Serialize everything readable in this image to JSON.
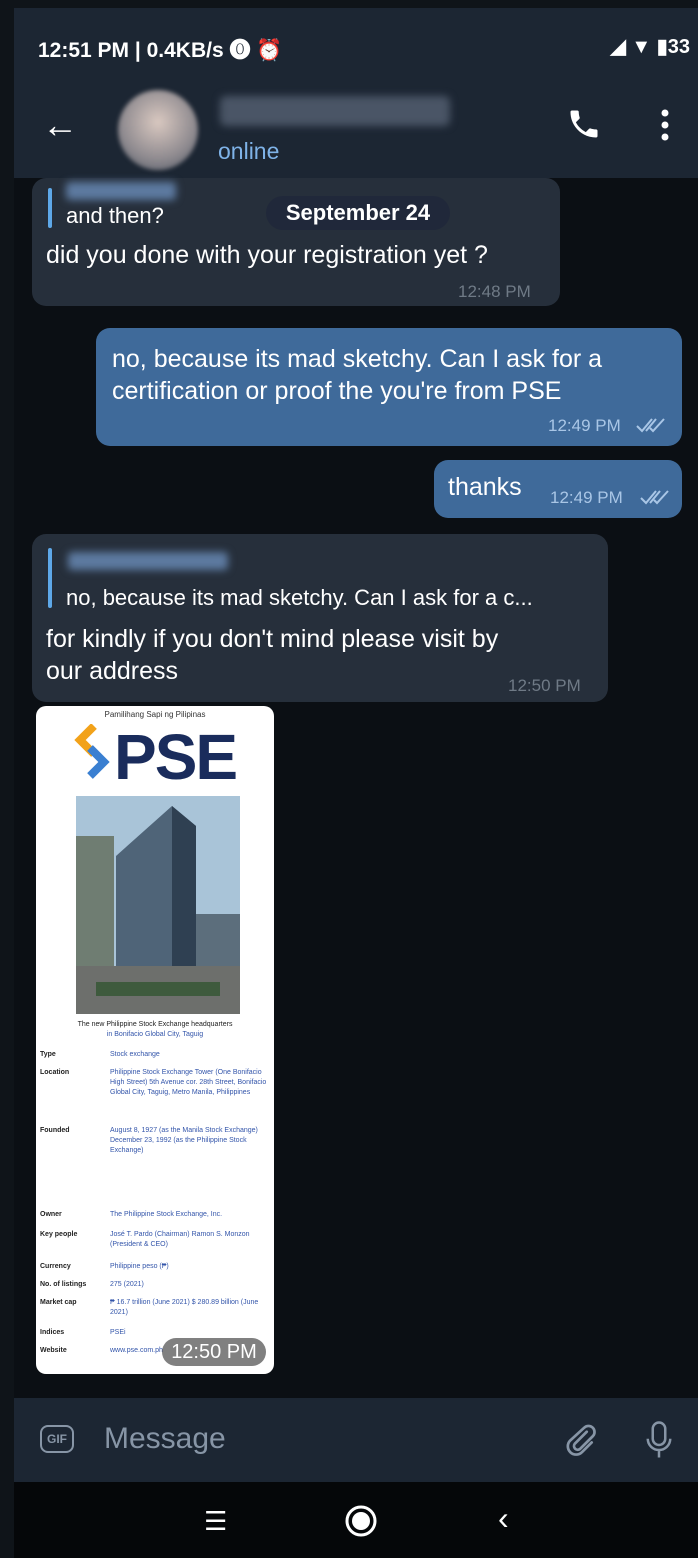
{
  "status_bar": {
    "time": "12:51 PM | 0.4KB/s ⓿ ⏰",
    "right": "◢ ▼ ▮33"
  },
  "header": {
    "back_icon": "arrow-left-icon",
    "presence": "online",
    "call_icon": "phone-icon",
    "menu_icon": "more-vert-icon"
  },
  "chat": {
    "date_separator": "September 24",
    "messages": [
      {
        "direction": "in",
        "reply_text": "and then?",
        "text": "did you done with your registration yet ?",
        "time": "12:48 PM"
      },
      {
        "direction": "out",
        "text_line1": "no, because its mad sketchy. Can I ask for a",
        "text_line2": "certification or proof the you're from PSE",
        "time": "12:49 PM",
        "status_icon": "double-check-icon"
      },
      {
        "direction": "out",
        "text": "thanks",
        "time": "12:49 PM",
        "status_icon": "double-check-icon"
      },
      {
        "direction": "in",
        "reply_text": "no, because its mad sketchy. Can I ask for a c...",
        "text_line1": "for kindly if you don't mind please visit by",
        "text_line2": "our address",
        "time": "12:50 PM"
      }
    ],
    "image_message": {
      "header": "Pamilihang Sapi ng Pilipinas",
      "logo_text": "PSE",
      "caption_line1": "The new Philippine Stock Exchange headquarters",
      "caption_line2": "in Bonifacio Global City, Taguig",
      "rows": [
        {
          "k": "Type",
          "v": "Stock exchange"
        },
        {
          "k": "Location",
          "v": "Philippine Stock Exchange Tower (One Bonifacio High Street) 5th Avenue cor. 28th Street, Bonifacio Global City, Taguig, Metro Manila, Philippines"
        },
        {
          "k": "Founded",
          "v": "August 8, 1927 (as the Manila Stock Exchange) December 23, 1992 (as the Philippine Stock Exchange)"
        },
        {
          "k": "Owner",
          "v": "The Philippine Stock Exchange, Inc."
        },
        {
          "k": "Key people",
          "v": "José T. Pardo (Chairman) Ramon S. Monzon (President & CEO)"
        },
        {
          "k": "Currency",
          "v": "Philippine peso (₱)"
        },
        {
          "k": "No. of listings",
          "v": "275 (2021)"
        },
        {
          "k": "Market cap",
          "v": "₱ 16.7 trillion (June 2021) $ 280.89 billion (June 2021)"
        },
        {
          "k": "Indices",
          "v": "PSEi"
        },
        {
          "k": "Website",
          "v": "www.pse.com.ph"
        }
      ],
      "time": "12:50 PM"
    }
  },
  "input": {
    "gif_label": "GIF",
    "placeholder": "Message",
    "attach_icon": "paperclip-icon",
    "mic_icon": "microphone-icon"
  },
  "nav": {
    "menu_icon": "recent-apps-icon",
    "home_icon": "home-circle-icon",
    "back_icon": "back-chevron-icon",
    "menu_glyph": "☰",
    "back_glyph": "‹"
  }
}
